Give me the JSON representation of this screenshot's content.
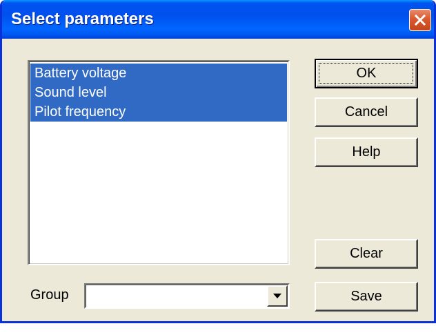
{
  "dialog": {
    "title": "Select parameters",
    "close_icon": "close-icon"
  },
  "parameters": {
    "items": [
      {
        "label": "Battery voltage",
        "selected": true
      },
      {
        "label": "Sound level",
        "selected": true
      },
      {
        "label": "Pilot frequency",
        "selected": true
      }
    ]
  },
  "buttons": {
    "ok_label": "OK",
    "cancel_label": "Cancel",
    "help_label": "Help",
    "clear_label": "Clear",
    "save_label": "Save"
  },
  "group": {
    "label": "Group",
    "value": "",
    "dropdown_icon": "chevron-down-icon"
  },
  "colors": {
    "title_bar": "#0054e3",
    "selection": "#316ac5",
    "dialog_face": "#ece9d8",
    "close_button": "#d9582f"
  }
}
